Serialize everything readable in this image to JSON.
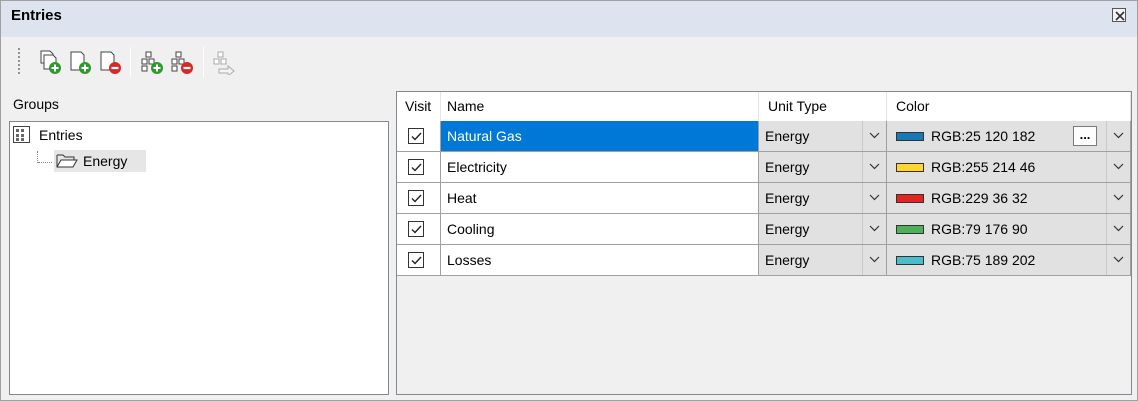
{
  "window": {
    "title": "Entries"
  },
  "toolbar": {
    "buttons": [
      {
        "name": "add-entry-copy",
        "icon": "doc-copy-add-icon",
        "enabled": true
      },
      {
        "name": "add-entry",
        "icon": "doc-add-icon",
        "enabled": true
      },
      {
        "name": "remove-entry",
        "icon": "doc-remove-icon",
        "enabled": true
      },
      {
        "name": "add-group",
        "icon": "group-add-icon",
        "enabled": true
      },
      {
        "name": "remove-group",
        "icon": "group-remove-icon",
        "enabled": true
      },
      {
        "name": "move-to-group",
        "icon": "group-move-icon",
        "enabled": false
      }
    ]
  },
  "groups": {
    "label": "Groups",
    "tree": {
      "root": {
        "label": "Entries",
        "icon": "entries-grid-icon"
      },
      "children": [
        {
          "label": "Energy",
          "icon": "folder-open-icon",
          "selected": true
        }
      ]
    }
  },
  "table": {
    "columns": [
      "Visit",
      "Name",
      "Unit Type",
      "Color"
    ],
    "rows": [
      {
        "visible": true,
        "name": "Natural Gas",
        "unit_type": "Energy",
        "color_label": "RGB:25 120 182",
        "swatch": "#1978b6",
        "selected": true
      },
      {
        "visible": true,
        "name": "Electricity",
        "unit_type": "Energy",
        "color_label": "RGB:255 214 46",
        "swatch": "#ffd62e",
        "selected": false
      },
      {
        "visible": true,
        "name": "Heat",
        "unit_type": "Energy",
        "color_label": "RGB:229 36 32",
        "swatch": "#e52420",
        "selected": false
      },
      {
        "visible": true,
        "name": "Cooling",
        "unit_type": "Energy",
        "color_label": "RGB:79 176 90",
        "swatch": "#4fb05a",
        "selected": false
      },
      {
        "visible": true,
        "name": "Losses",
        "unit_type": "Energy",
        "color_label": "RGB:75 189 202",
        "swatch": "#4bbdca",
        "selected": false
      }
    ],
    "ellipsis_label": "..."
  },
  "colors": {
    "selection": "#0078d7",
    "titlebar": "#dde3ef"
  }
}
